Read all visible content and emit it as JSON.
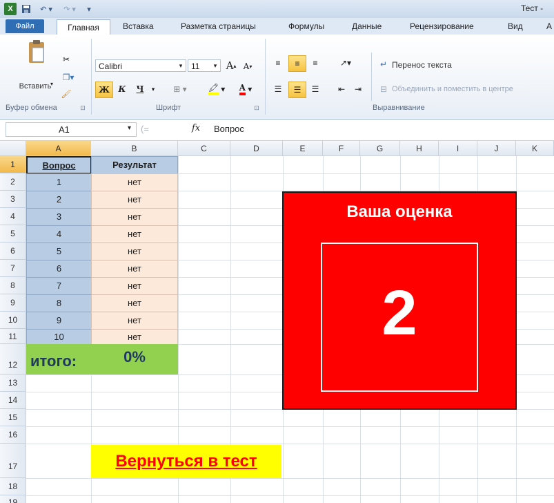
{
  "window": {
    "title": "Тест - "
  },
  "ribbon_tabs": [
    "Файл",
    "Главная",
    "Вставка",
    "Разметка страницы",
    "Формулы",
    "Данные",
    "Рецензирование",
    "Вид",
    "А"
  ],
  "clipboard": {
    "paste_label": "Вставить",
    "group": "Буфер обмена"
  },
  "font": {
    "name": "Calibri",
    "size": "11",
    "group": "Шрифт",
    "bold": "Ж",
    "italic": "К",
    "underline": "Ч",
    "grow": "A",
    "shrink": "A"
  },
  "alignment": {
    "wrap_text": "Перенос текста",
    "merge_center": "Объединить и поместить в центре",
    "group": "Выравнивание"
  },
  "formula_bar": {
    "name_box": "A1",
    "fx": "fx",
    "value": "Вопрос"
  },
  "columns": [
    "A",
    "B",
    "C",
    "D",
    "E",
    "F",
    "G",
    "H",
    "I",
    "J",
    "K"
  ],
  "rows": [
    "1",
    "2",
    "3",
    "4",
    "5",
    "6",
    "7",
    "8",
    "9",
    "10",
    "11",
    "12",
    "13",
    "14",
    "15",
    "16",
    "17",
    "18",
    "19"
  ],
  "table": {
    "headers": [
      "Вопрос",
      "Результат"
    ],
    "questions": [
      "1",
      "2",
      "3",
      "4",
      "5",
      "6",
      "7",
      "8",
      "9",
      "10"
    ],
    "results": [
      "нет",
      "нет",
      "нет",
      "нет",
      "нет",
      "нет",
      "нет",
      "нет",
      "нет",
      "нет"
    ],
    "total_label": "итого:",
    "total_value": "0%"
  },
  "score": {
    "title": "Ваша оценка",
    "value": "2"
  },
  "back_link": "Вернуться в тест",
  "colors": {
    "panel": "#ff0000",
    "total_bg": "#92d050",
    "link_bg": "#ffff00",
    "link_text": "#ff0000",
    "col_a": "#b8cce4",
    "col_b": "#fde9d9"
  }
}
